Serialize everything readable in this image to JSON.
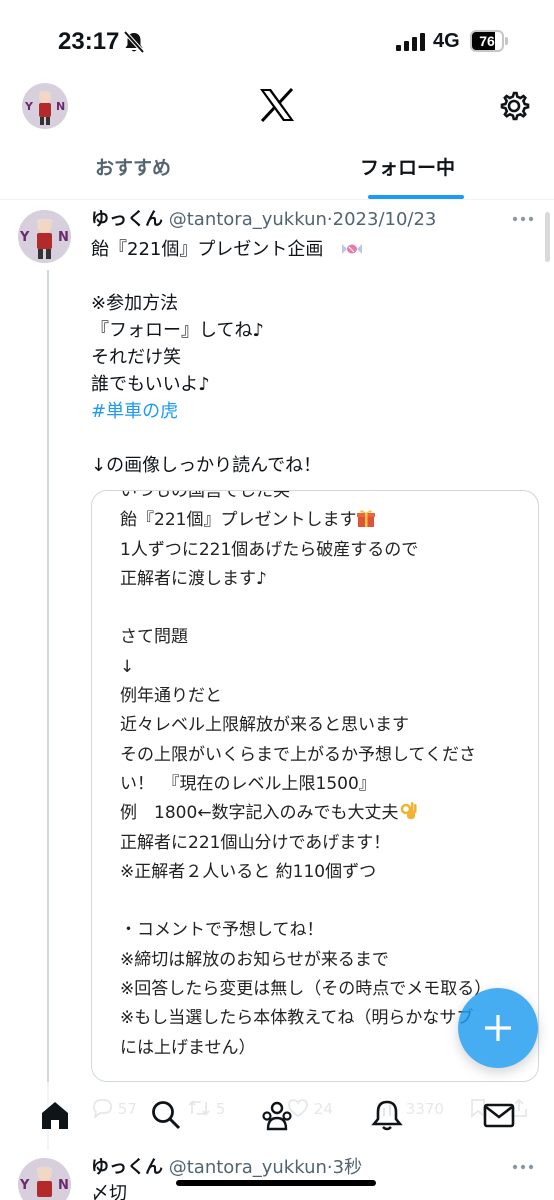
{
  "status_bar": {
    "time": "23:17",
    "network": "4G",
    "battery": "76",
    "battery_level": 0.76
  },
  "header": {
    "logo_icon": "x-logo-icon",
    "settings_icon": "gear-icon"
  },
  "tabs": [
    {
      "label": "おすすめ",
      "active": false
    },
    {
      "label": "フォロー中",
      "active": true
    }
  ],
  "tweet": {
    "author_name": "ゆっくん",
    "handle": "@tantora_yukkun",
    "separator": "·",
    "date": "2023/10/23",
    "lines": [
      "飴『221個』プレゼント企画",
      "",
      "※参加方法",
      "『フォロー』してね♪",
      "それだけ笑",
      "誰でもいいよ♪",
      "#単車の虎",
      "",
      "↓の画像しっかり読んでね！"
    ],
    "image_text": [
      "いつもの国営でした笑",
      "飴『221個』プレゼントします",
      "1人ずつに221個あげたら破産するので",
      "正解者に渡します♪",
      "",
      "さて問題",
      "↓",
      "例年通りだと",
      "近々レベル上限解放が来ると思います",
      "その上限がいくらまで上がるか予想してくださ",
      "い！　『現在のレベル上限1500』",
      "例　1800←数字記入のみでも大丈夫",
      "正解者に221個山分けであげます！",
      "※正解者２人いると 約110個ずつ",
      "",
      "・コメントで予想してね！",
      "※締切は解放のお知らせが来るまで",
      "※回答したら変更は無し（その時点でメモ取る）",
      "※もし当選したら本体教えてね（明らかなサブ",
      "には上げません）"
    ],
    "actions": {
      "replies": "57",
      "reposts": "5",
      "likes": "24",
      "views": "3370"
    }
  },
  "tweet2": {
    "author_name": "ゆっくん",
    "handle": "@tantora_yukkun",
    "separator": "·",
    "time": "3秒",
    "text": "〆切"
  },
  "colors": {
    "accent": "#1d9bf0",
    "text": "#0f1419",
    "secondary": "#536471"
  }
}
